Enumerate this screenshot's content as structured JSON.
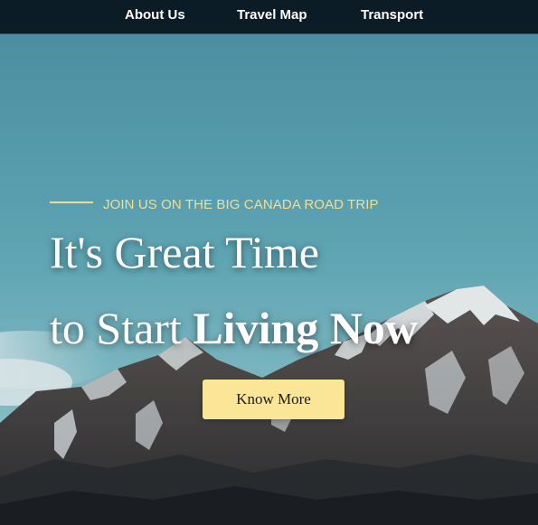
{
  "nav": {
    "items": [
      {
        "label": "About Us"
      },
      {
        "label": "Travel Map"
      },
      {
        "label": "Transport"
      }
    ]
  },
  "hero": {
    "tagline": "JOIN US ON THE BIG CANADA ROAD TRIP",
    "headline_line1": "It's Great Time",
    "headline_line2_regular": "to Start ",
    "headline_line2_bold": "Living Now",
    "cta_label": "Know More",
    "background": "mountain-photo"
  },
  "colors": {
    "nav_background": "#0b1c27",
    "accent_gold": "#f5dd8f",
    "button_background": "#fbe596",
    "sky_blue": "#5aa1b1"
  }
}
